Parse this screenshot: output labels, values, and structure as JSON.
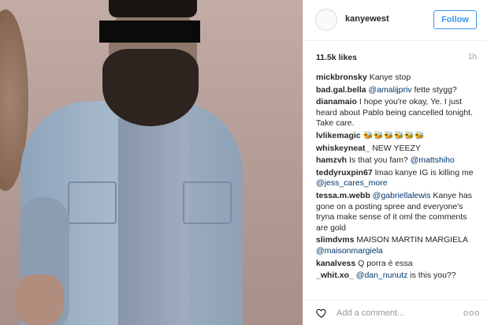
{
  "post": {
    "username": "kanyewest",
    "follow_label": "Follow",
    "likes": "11.5k likes",
    "time": "1h"
  },
  "comments": [
    {
      "user": "mickbronsky",
      "text": " Kanye stop"
    },
    {
      "user": "bad.gal.bella",
      "text": " @amalijpriv fette stygg?"
    },
    {
      "user": "dianamaio",
      "text": " I hope you're okay, Ye. I just heard about Pablo being cancelled tonight. Take care."
    },
    {
      "user": "lvlikemagic",
      "text": " 🐝🐝🐝🐝🐝🐝"
    },
    {
      "user": "whiskeyneat_",
      "text": " NEW YEEZY"
    },
    {
      "user": "hamzvh",
      "text": " Is that you fam? @mattshiho"
    },
    {
      "user": "teddyruxpin67",
      "text": " lmao kanye IG is killing me @jess_cares_more"
    },
    {
      "user": "tessa.m.webb",
      "text": " @gabriellalewis Kanye has gone on a posting spree and everyone's tryna make sense of it oml the comments are gold"
    },
    {
      "user": "slimdvms",
      "text": " MAISON MARTIN MARGIELA @maisonmargiela"
    },
    {
      "user": "kanalvess",
      "text": " Q porra é essa"
    },
    {
      "user": "_whit.xo_",
      "text": " @dan_nunutz is this you??"
    }
  ],
  "add_comment": {
    "placeholder": "Add a comment...",
    "more": "ooo"
  },
  "icons": {
    "like": "heart-icon",
    "avatar": "avatar-icon"
  },
  "colors": {
    "follow_blue": "#3897f0",
    "mention": "#003569"
  }
}
